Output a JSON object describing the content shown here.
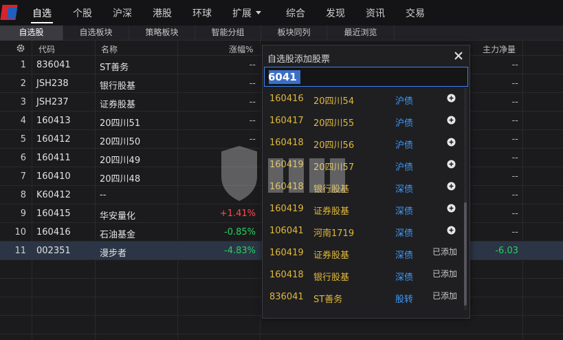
{
  "menu": {
    "items": [
      {
        "label": "自选",
        "active": true
      },
      {
        "label": "个股"
      },
      {
        "label": "沪深"
      },
      {
        "label": "港股"
      },
      {
        "label": "环球"
      },
      {
        "label": "扩展"
      },
      {
        "label": "综合"
      },
      {
        "label": "发现"
      },
      {
        "label": "资讯"
      },
      {
        "label": "交易"
      }
    ]
  },
  "subtabs": [
    {
      "label": "自选股",
      "active": true
    },
    {
      "label": "自选板块"
    },
    {
      "label": "策略板块"
    },
    {
      "label": "智能分组"
    },
    {
      "label": "板块同列"
    },
    {
      "label": "最近浏览"
    }
  ],
  "table": {
    "headers": {
      "code": "代码",
      "name": "名称",
      "change": "涨幅%",
      "netflow": "主力净量"
    },
    "rows": [
      {
        "index": "1",
        "code": "836041",
        "name": "ST善务",
        "change": "--",
        "flow": "--"
      },
      {
        "index": "2",
        "code": "JSH238",
        "name": "银行股基",
        "change": "--",
        "flow": "--"
      },
      {
        "index": "3",
        "code": "JSH237",
        "name": "证券股基",
        "change": "--",
        "flow": "--"
      },
      {
        "index": "4",
        "code": "160413",
        "name": "20四川51",
        "change": "--",
        "flow": "--"
      },
      {
        "index": "5",
        "code": "160412",
        "name": "20四川50",
        "change": "--",
        "flow": "--"
      },
      {
        "index": "6",
        "code": "160411",
        "name": "20四川49",
        "change": "",
        "flow": "--"
      },
      {
        "index": "7",
        "code": "160410",
        "name": "20四川48",
        "change": "",
        "flow": "--"
      },
      {
        "index": "8",
        "code": "K60412",
        "name": "--",
        "change": "",
        "flow": "--"
      },
      {
        "index": "9",
        "code": "160415",
        "name": "华安量化",
        "change": "+1.41%",
        "flow": "--"
      },
      {
        "index": "10",
        "code": "160416",
        "name": "石油基金",
        "change": "-0.85%",
        "flow": "--"
      },
      {
        "index": "11",
        "code": "002351",
        "name": "漫步者",
        "change": "-4.83%",
        "flow": "-6.03"
      }
    ]
  },
  "dialog": {
    "title": "自选股添加股票",
    "query": "6041",
    "results": [
      {
        "code": "160416",
        "name": "20四川54",
        "type": "沪债",
        "added": false
      },
      {
        "code": "160417",
        "name": "20四川55",
        "type": "沪债",
        "added": false
      },
      {
        "code": "160418",
        "name": "20四川56",
        "type": "沪债",
        "added": false
      },
      {
        "code": "160419",
        "name": "20四川57",
        "type": "沪债",
        "added": false
      },
      {
        "code": "160418",
        "name": "银行股基",
        "type": "深债",
        "added": false
      },
      {
        "code": "160419",
        "name": "证券股基",
        "type": "深债",
        "added": false
      },
      {
        "code": "106041",
        "name": "河南1719",
        "type": "深债",
        "added": false
      },
      {
        "code": "160419",
        "name": "证券股基",
        "type": "深债",
        "added": true,
        "added_label": "已添加"
      },
      {
        "code": "160418",
        "name": "银行股基",
        "type": "深债",
        "added": true,
        "added_label": "已添加"
      },
      {
        "code": "836041",
        "name": "ST善务",
        "type": "股转",
        "added": true,
        "added_label": "已添加"
      }
    ]
  },
  "colors": {
    "up": "#ff4b4b",
    "down": "#27d35e",
    "accent": "#3b9cff",
    "code": "#e1b93a"
  }
}
